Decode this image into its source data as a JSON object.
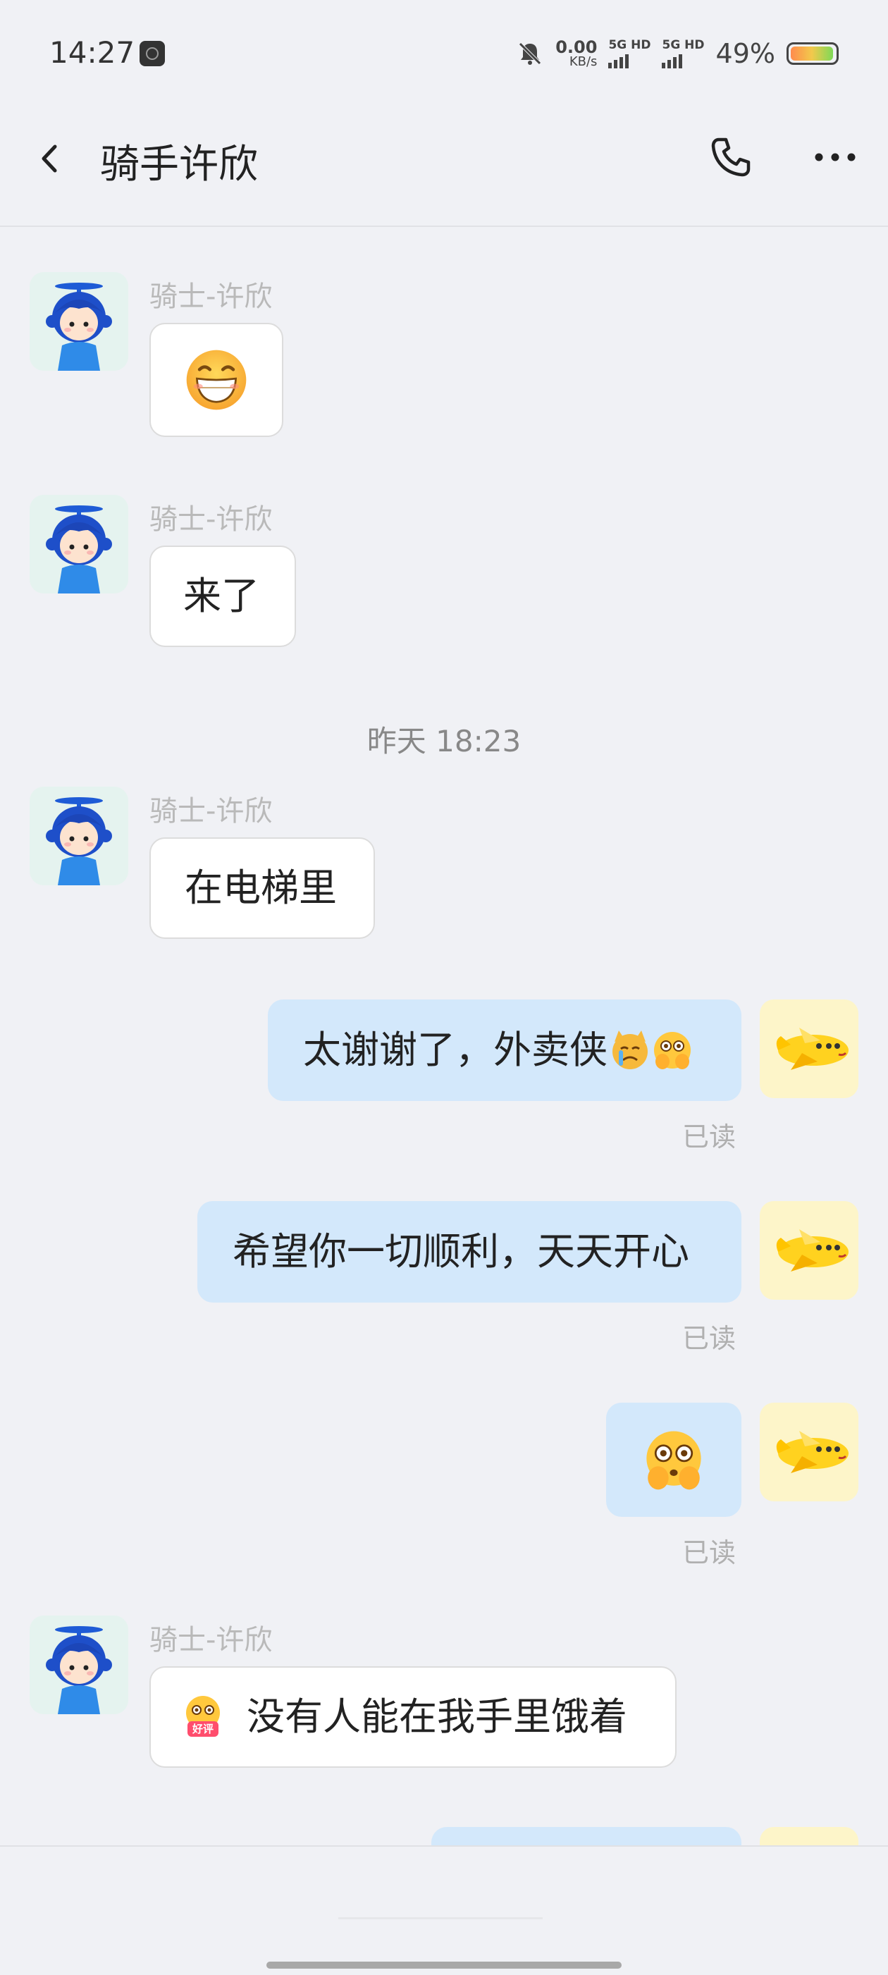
{
  "status_bar": {
    "time": "14:27",
    "net_speed_value": "0.00",
    "net_speed_unit": "KB/s",
    "sim1_label": "5G HD",
    "sim2_label": "5G HD",
    "battery_percent": "49%",
    "battery_level": 0.49
  },
  "header": {
    "title": "骑手许欣"
  },
  "chat": {
    "messages": [
      {
        "side": "in",
        "sender": "骑士-许欣",
        "text": "",
        "emoji": "grinning-face"
      },
      {
        "side": "in",
        "sender": "骑士-许欣",
        "text": "来了"
      },
      {
        "side": "in",
        "sender": "骑士-许欣",
        "text": "在电梯里"
      },
      {
        "side": "out",
        "text": "太谢谢了，外卖侠",
        "read": "已读",
        "emoji": "crying-cat, pleading-face"
      },
      {
        "side": "out",
        "text": "希望你一切顺利，天天开心",
        "read": "已读"
      },
      {
        "side": "out",
        "text": "",
        "read": "已读",
        "emoji": "pleading-face"
      },
      {
        "side": "in",
        "sender": "骑士-许欣",
        "text": "没有人能在我手里饿着",
        "emoji": "haoping-sticker",
        "sticker_text": "好评"
      }
    ],
    "timestamp": "昨天 18:23"
  },
  "colors": {
    "background": "#f0f1f5",
    "outgoing_bubble": "#d3e8fb",
    "incoming_bubble": "#ffffff",
    "rider_avatar_bg": "#e5f3ef",
    "my_avatar_bg": "#fdf5c9"
  }
}
